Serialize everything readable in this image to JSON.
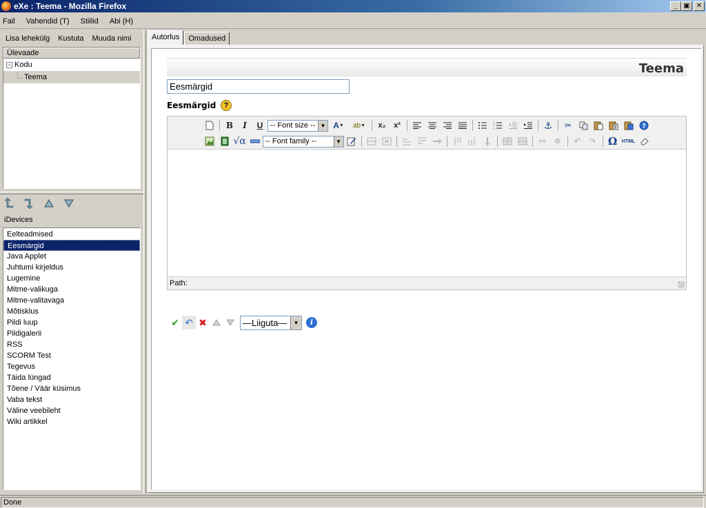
{
  "window": {
    "title": "eXe : Teema - Mozilla Firefox",
    "min": "_",
    "max": "▣",
    "close": "✕"
  },
  "menu": [
    {
      "label": "Fail"
    },
    {
      "label": "Vahendid (T)"
    },
    {
      "label": "Stiilid"
    },
    {
      "label": "Abi (H)"
    }
  ],
  "outline_tools": {
    "add": "Lisa lehekülg",
    "delete": "Kustuta",
    "rename": "Muuda nimi"
  },
  "outline": {
    "header": "Ülevaade",
    "root": "Kodu",
    "expander": "−",
    "child": "Teema"
  },
  "idevices": {
    "label": "iDevices",
    "items": [
      "Eelteadmised",
      "Eesmärgid",
      "Java Applet",
      "Juhtumi kirjeldus",
      "Lugemine",
      "Mitme-valikuga",
      "Mitme-valitavaga",
      "Mõtisklus",
      "Pildi luup",
      "Pildigalerii",
      "RSS",
      "SCORM Test",
      "Tegevus",
      "Täida lüngad",
      "Tõene / Väär küsimus",
      "Vaba tekst",
      "Väline veebileht",
      "Wiki artikkel"
    ],
    "selected_index": 1
  },
  "tabs": [
    {
      "label": "Autorlus"
    },
    {
      "label": "Omadused"
    }
  ],
  "page": {
    "title": "Teema",
    "input_value": "Eesmärgid",
    "field_label": "Eesmärgid",
    "help": "?"
  },
  "editor": {
    "font_size": "-- Font size --",
    "font_family": "-- Font family --",
    "path_label": "Path:",
    "html_btn": "HTML"
  },
  "actions": {
    "move_value": "—Liiguta—",
    "info": "i"
  },
  "status": "Done"
}
